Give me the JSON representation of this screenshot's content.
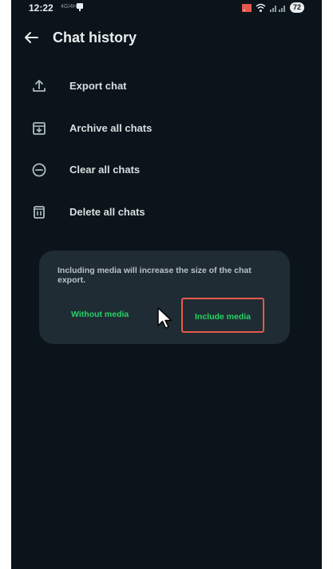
{
  "status_bar": {
    "time": "12:22",
    "small_icon_text": "4G/4H",
    "battery": "72"
  },
  "header": {
    "title": "Chat history",
    "back_icon": "arrow-left-icon"
  },
  "menu": {
    "items": [
      {
        "label": "Export chat",
        "icon": "upload-icon"
      },
      {
        "label": "Archive all chats",
        "icon": "archive-icon"
      },
      {
        "label": "Clear all chats",
        "icon": "minus-circle-icon"
      },
      {
        "label": "Delete all chats",
        "icon": "trash-icon"
      }
    ]
  },
  "dialog": {
    "message": "Including media will increase the size of the chat export.",
    "without_media_label": "Without media",
    "include_media_label": "Include media"
  },
  "colors": {
    "background": "#0b141a",
    "dialog_background": "#1f2c33",
    "accent_green": "#25d366",
    "highlight_red": "#e55a4e",
    "text_primary": "#e9edef"
  }
}
